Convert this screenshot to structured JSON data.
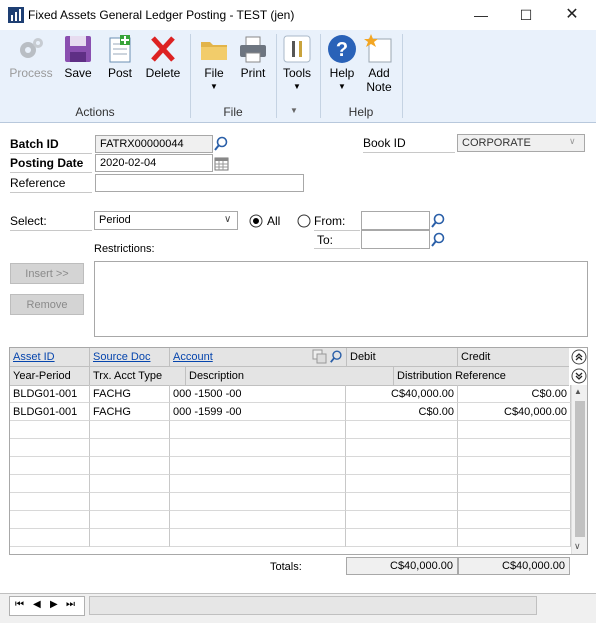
{
  "window": {
    "title": "Fixed Assets General Ledger Posting  -  TEST (jen)"
  },
  "ribbon": {
    "buttons": {
      "process": "Process",
      "save": "Save",
      "post": "Post",
      "delete": "Delete",
      "file": "File",
      "print": "Print",
      "tools": "Tools",
      "help": "Help",
      "add_note_1": "Add",
      "add_note_2": "Note"
    },
    "groups": {
      "actions": "Actions",
      "file": "File",
      "help": "Help"
    }
  },
  "form": {
    "batch_id_label": "Batch ID",
    "batch_id": "FATRX00000044",
    "posting_date_label": "Posting Date",
    "posting_date": "2020-02-04",
    "reference_label": "Reference",
    "reference": "",
    "book_id_label": "Book ID",
    "book_id": "CORPORATE",
    "select_label": "Select:",
    "select_value": "Period",
    "all_label": "All",
    "from_label": "From:",
    "to_label": "To:",
    "restrictions_label": "Restrictions:",
    "insert_label": "Insert >>",
    "remove_label": "Remove"
  },
  "grid": {
    "headers": {
      "asset_id": "Asset ID",
      "source_doc": "Source Doc",
      "account": "Account",
      "debit": "Debit",
      "credit": "Credit",
      "year_period": "Year-Period",
      "trx_acct_type": "Trx. Acct Type",
      "description": "Description",
      "distribution_reference": "Distribution Reference"
    },
    "rows": [
      {
        "year_period": "BLDG01-001",
        "trx_type": "FACHG",
        "account": "000 -1500 -00",
        "debit": "C$40,000.00",
        "credit": "C$0.00"
      },
      {
        "year_period": "BLDG01-001",
        "trx_type": "FACHG",
        "account": "000 -1599 -00",
        "debit": "C$0.00",
        "credit": "C$40,000.00"
      }
    ],
    "totals_label": "Totals:",
    "total_debit": "C$40,000.00",
    "total_credit": "C$40,000.00"
  },
  "colors": {
    "accent": "#0645ad",
    "ribbon_bg": "#e9f1fb"
  }
}
